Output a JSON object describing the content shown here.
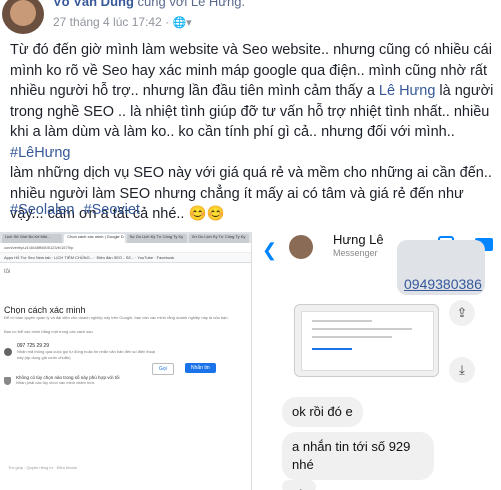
{
  "header": {
    "author": "Võ Văn Dũng",
    "with_text": "cùng với Lê Hưng.",
    "timestamp": "27 tháng 4 lúc 17:42 ·",
    "globe_icon": "globe-icon"
  },
  "post": {
    "text": "Từ đó đến giờ mình làm website và Seo website.. nhưng cũng có nhiều cái mình ko rõ về Seo hay xác minh máp google qua điện.. mình cũng nhờ rất nhiều người hỗ trợ.. nhưng lần đầu tiên mình cảm thấy a ",
    "mention1": "Lê Hưng",
    "text2": " là người trong nghề SEO .. là nhiệt tình giúp đỡ tư vấn hỗ trợ nhiệt tình nhất.. nhiều khi a làm dùm và làm ko.. ko cần tính phí gì cả.. nhưng đối với mình.. ",
    "hashtag_inline": "#LêHưng",
    "text3": "\nlàm những dịch vụ SEO này với giá quá rẻ và mềm cho những ai cần đến.. nhiều người làm SEO nhưng chẳng ít mấy ai có tâm và giá rẻ đến như vậy... cảm ơn a tất cả nhé.. 😊😊"
  },
  "tags": [
    "#Seolalen",
    "#Seoviet"
  ],
  "screenshot_left": {
    "tabs": [
      "Lịch Sử Giới Bo Kế Mtrl...",
      "Chọn cách xác minh | Google D...",
      "Sự Do Lịch Kỳ Tư Công Ty Ky",
      "Xứ Du Lịch Kỳ Tư Công Ty Ky"
    ],
    "address": "com/verify/u/1/4648ff4505123/b/1579/p",
    "bookmarks": "Apps  Hỗ Trợ Seo  New tab  ·  LỊCH TIÊM CHỦNG...  ·  Điện đàn SEO - Sổ...  ·  YouTube  ·  Facebook",
    "page_label": "tôi",
    "title": "Chọn cách xác minh",
    "desc": "Để có toàn quyền quản lý và đại diện cho doanh nghiệp này trên Google, bạn cần xác minh rằng doanh nghiệp này là của bạn.",
    "subhead": "Bạn có thể xác minh bằng một trong các cách sau",
    "phone": "097 725 29 29",
    "phone_desc": "Nhận mã thông qua cuộc gọi tự động hoặc tin nhắn văn bản đến số điện thoại này (áp dụng giá cước chuẩn)",
    "call_btn": "Gọi",
    "sms_btn": "Nhắn tin",
    "no_option": "Không có tùy chọn nào trong số này phù hợp với tôi",
    "no_option_sub": "Nhận phải các tùy chọn xác minh chậm hơn.",
    "footer": "Trợ giúp · Quyền riêng tư · Điều khoản"
  },
  "screenshot_right": {
    "back_icon": "back-chevron-icon",
    "name": "Hưng Lê",
    "status": "Messenger",
    "number": "0949380386",
    "messages": [
      "ok rồi đó e",
      "a nhắn tin tới số 929 nhé",
      "ok"
    ]
  }
}
